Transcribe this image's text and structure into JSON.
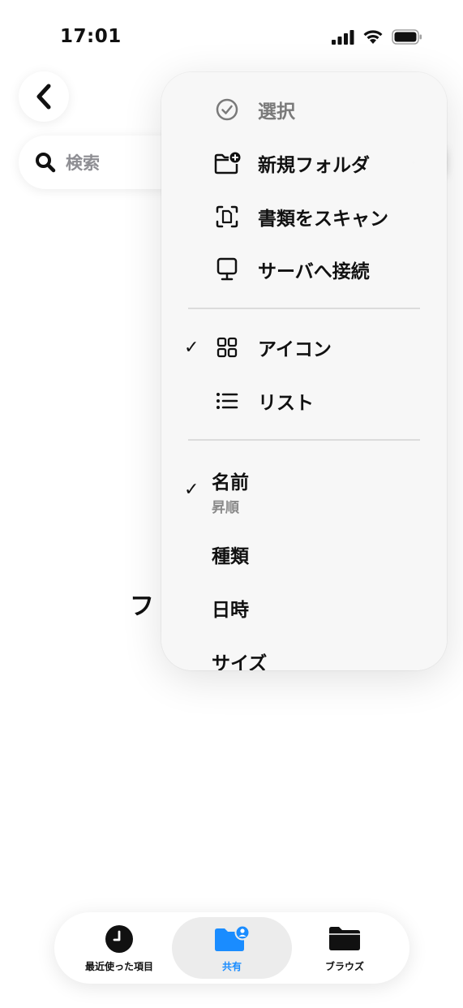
{
  "status": {
    "time": "17:01"
  },
  "search": {
    "placeholder": "検索"
  },
  "main": {
    "empty_message": "フ"
  },
  "menu": {
    "actions": [
      {
        "label": "選択",
        "icon": "checkmark-circle-icon",
        "dimmed": true
      },
      {
        "label": "新規フォルダ",
        "icon": "folder-add-icon"
      },
      {
        "label": "書類をスキャン",
        "icon": "doc-scan-icon"
      },
      {
        "label": "サーバへ接続",
        "icon": "server-display-icon"
      }
    ],
    "views": [
      {
        "label": "アイコン",
        "icon": "grid-icon",
        "checked": true
      },
      {
        "label": "リスト",
        "icon": "list-icon",
        "checked": false
      }
    ],
    "sort": [
      {
        "label": "名前",
        "sublabel": "昇順",
        "checked": true
      },
      {
        "label": "種類"
      },
      {
        "label": "日時"
      },
      {
        "label": "サイズ"
      }
    ]
  },
  "tabs": [
    {
      "label": "最近使った項目",
      "icon": "clock-icon",
      "active": false
    },
    {
      "label": "共有",
      "icon": "shared-folder-icon",
      "active": true
    },
    {
      "label": "ブラウズ",
      "icon": "folder-icon",
      "active": false
    }
  ],
  "colors": {
    "accent": "#1a8cff",
    "dim_text": "#8e8e93"
  }
}
